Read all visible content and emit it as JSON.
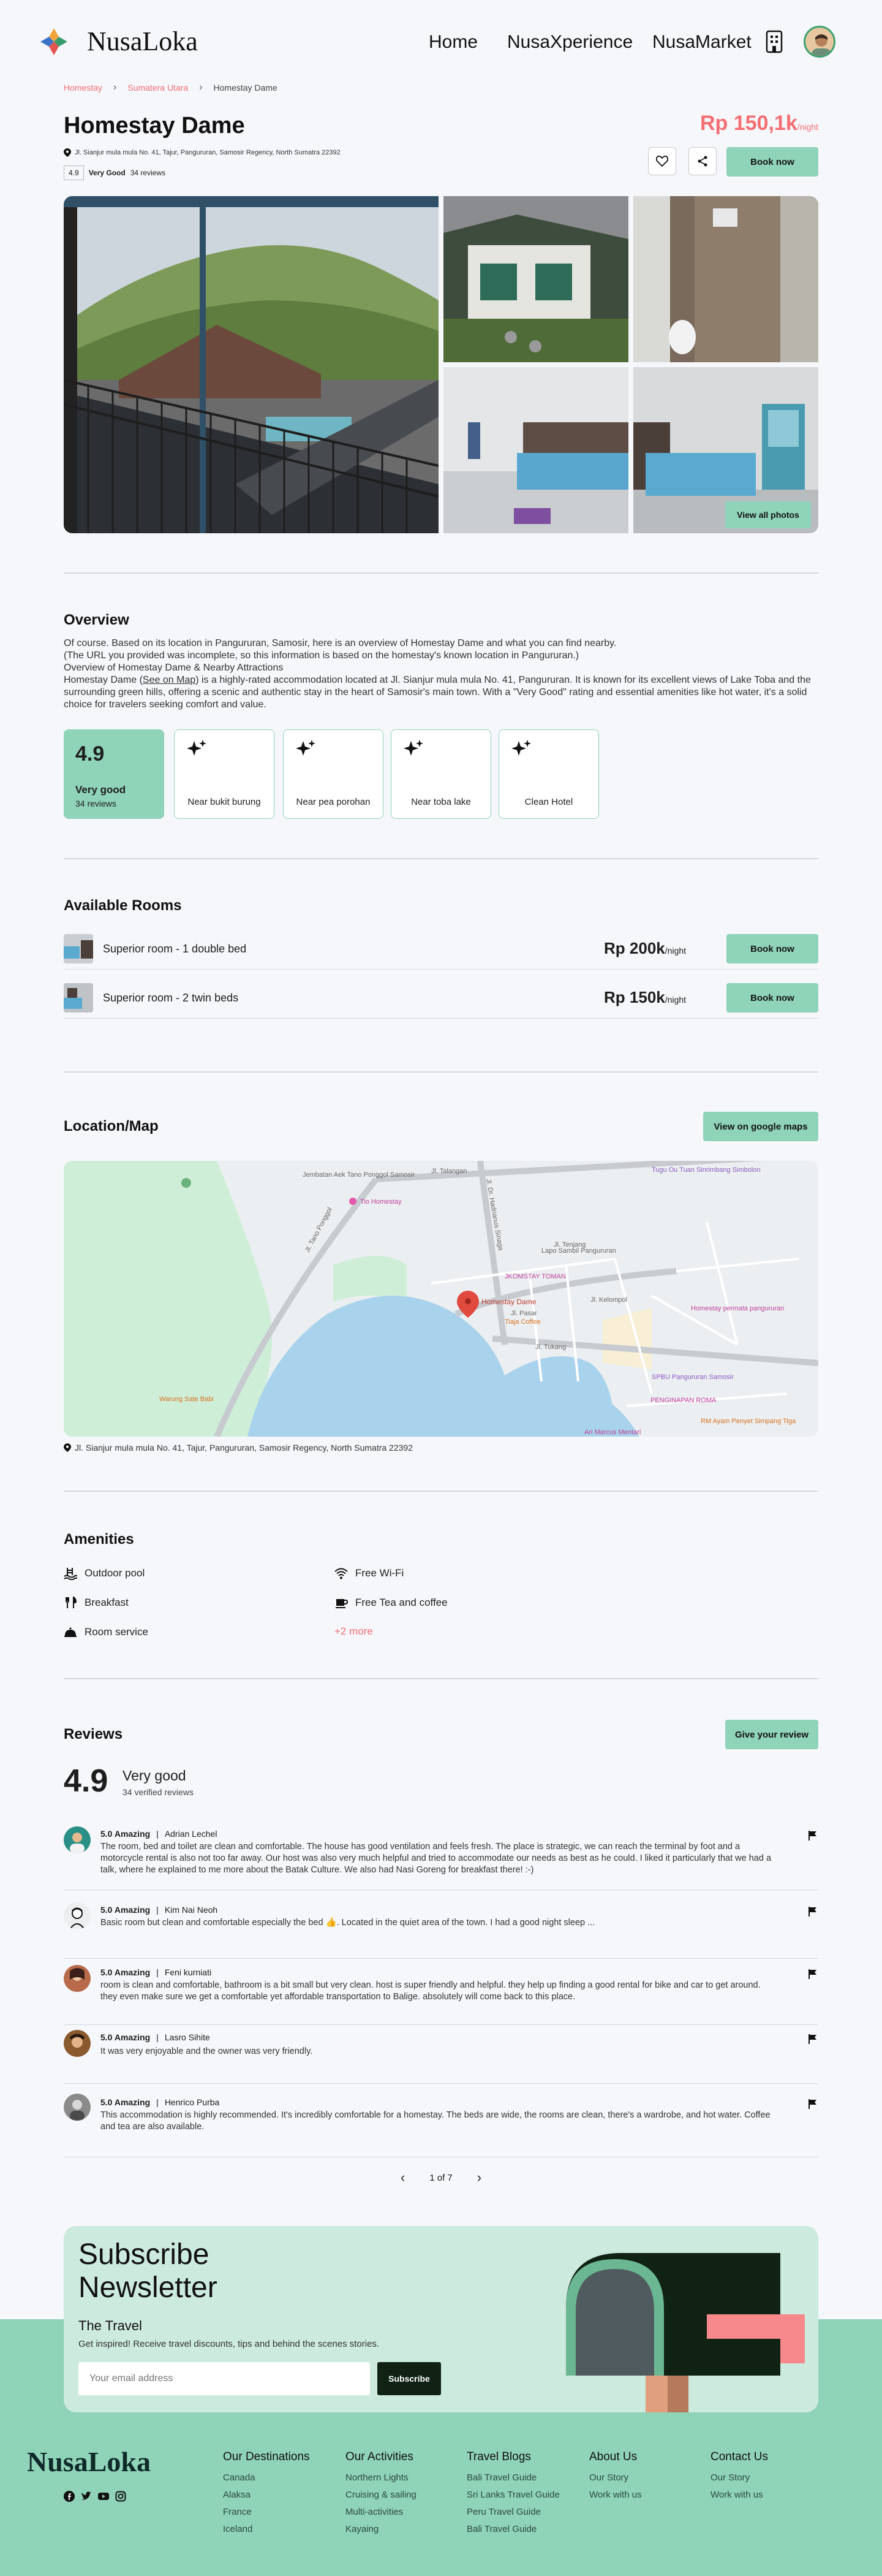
{
  "header": {
    "logo_text": "NusaLoka",
    "nav": [
      "Home",
      "NusaXperience",
      "NusaMarket"
    ]
  },
  "breadcrumb": [
    "Homestay",
    "Sumatera Utara",
    "Homestay Dame"
  ],
  "property": {
    "title": "Homestay Dame",
    "address": "Jl. Sianjur mula mula No. 41, Tajur, Pangururan, Samosir Regency, North Sumatra 22392",
    "rating": "4.9",
    "rating_label": "Very Good",
    "reviews_count": "34 reviews",
    "price": "Rp 150,1k",
    "price_unit": "/night",
    "book_label": "Book now",
    "view_all_label": "View all photos"
  },
  "overview": {
    "heading": "Overview",
    "lines": [
      "Of course. Based on its location in Pangururan, Samosir, here is an overview of Homestay Dame and what you can find nearby.",
      "(The URL you provided was incomplete, so this information is based on the homestay's known location in Pangururan.)",
      "Overview of Homestay Dame & Nearby Attractions"
    ],
    "para_before_link": "Homestay Dame (",
    "link_text": "See on Map",
    "para_after_link": ") is a highly-rated accommodation located at Jl. Sianjur mula mula No. 41, Pangururan. It is known for its excellent views of Lake Toba and the surrounding green hills, offering a scenic and authentic stay in the heart of Samosir's main town. With a \"Very Good\" rating and essential amenities like hot water, it's a solid choice for travelers seeking comfort and value.",
    "score": "4.9",
    "score_label": "Very good",
    "score_reviews": "34 reviews",
    "features": [
      "Near bukit burung",
      "Near pea porohan",
      "Near toba lake",
      "Clean Hotel"
    ]
  },
  "rooms": {
    "heading": "Available Rooms",
    "items": [
      {
        "name": "Superior room - 1 double bed",
        "price": "Rp 200k",
        "unit": "/night",
        "button": "Book now"
      },
      {
        "name": "Superior room -  2 twin beds",
        "price": "Rp 150k",
        "unit": "/night",
        "button": "Book now"
      }
    ]
  },
  "map": {
    "heading": "Location/Map",
    "button": "View on google maps",
    "labels": {
      "pin": "Homestay Dame",
      "l1": "Jembatan Aek Tano Ponggol Samosir",
      "l2": "Tio Homestay",
      "l3": "Tugu Ou Tuan Sinrimbang Simbolon",
      "l4": "Lapo Sambil Pangururan",
      "l5": "JKOMSTAY TOMAN",
      "l6": "Tiaja Coffee",
      "l7": "Homestay permata pangururan",
      "l8": "SPBU Pangururan Samosir",
      "l9": "PENGINAPAN ROMA",
      "l10": "RM Ayam Penyet Simpang Tiga",
      "l11": "Warung Sate Babi",
      "l12": "Ari Marcus Mentari",
      "r1": "Jl. Tano Ponggol",
      "r2": "Jl. Talangan",
      "r3": "Jl. Dr. Hadrianus Sinaga",
      "r4": "Jl. Tenjang",
      "r5": "Jl. Pasar",
      "r6": "Jl. Kelompol",
      "r7": "Jl. Tukang"
    },
    "address": "Jl. Sianjur mula mula No. 41, Tajur, Pangururan, Samosir Regency, North Sumatra 22392"
  },
  "amenities": {
    "heading": "Amenities",
    "left": [
      "Outdoor pool",
      "Breakfast",
      "Room service"
    ],
    "right": [
      "Free Wi-Fi",
      "Free Tea and coffee"
    ],
    "more": "+2 more"
  },
  "reviews": {
    "heading": "Reviews",
    "button": "Give your review",
    "score": "4.9",
    "label": "Very good",
    "count": "34 verified reviews",
    "items": [
      {
        "score": "5.0 Amazing",
        "sep": "|",
        "name": "Adrian Lechel",
        "body": "The room, bed and toilet are clean and comfortable. The house has good ventilation and feels fresh. The place is strategic, we can reach the terminal by foot and a motorcycle rental is also not too far away. Our host was also very much helpful and tried to accommodate our needs as best as he could. I liked it particularly that we had a talk, where he explained to me more about the Batak Culture. We also had Nasi Goreng for breakfast there! :-)"
      },
      {
        "score": "5.0 Amazing",
        "sep": "|",
        "name": "Kim Nai Neoh",
        "body": "Basic room but clean and comfortable especially the bed 👍. Located in the quiet area of the town. I had a good night sleep ..."
      },
      {
        "score": "5.0 Amazing",
        "sep": "|",
        "name": "Feni kurniati",
        "body": "room is clean and comfortable, bathroom is a bit small but very clean. host is super friendly and helpful. they help up finding a good rental for bike and car to get around. they even make sure we get a comfortable yet affordable transportation to Balige. absolutely will come back to this place."
      },
      {
        "score": "5.0 Amazing",
        "sep": "|",
        "name": "Lasro Sihite",
        "body": "It was very enjoyable and the owner was very friendly."
      },
      {
        "score": "5.0 Amazing",
        "sep": "|",
        "name": "Henrico Purba",
        "body": "This accommodation is highly recommended. It's incredibly comfortable for a homestay. The beds are wide, the rooms are clean, there's a wardrobe, and hot water. Coffee and tea are also available."
      }
    ],
    "pager": "1 of 7"
  },
  "newsletter": {
    "title_line1": "Subscribe",
    "title_line2": "Newsletter",
    "subtitle": "The Travel",
    "desc": "Get inspired! Receive travel discounts, tips and behind the scenes stories.",
    "placeholder": "Your email address",
    "button": "Subscribe"
  },
  "footer": {
    "logo_text": "NusaLoka",
    "columns": [
      {
        "title": "Our Destinations",
        "items": [
          "Canada",
          "Alaksa",
          "France",
          "Iceland"
        ]
      },
      {
        "title": "Our Activities",
        "items": [
          "Northern Lights",
          "Cruising & sailing",
          "Multi-activities",
          "Kayaing"
        ]
      },
      {
        "title": "Travel Blogs",
        "items": [
          "Bali Travel Guide",
          "Sri Lanks Travel Guide",
          "Peru Travel Guide",
          "Bali Travel Guide"
        ]
      },
      {
        "title": "About Us",
        "items": [
          "Our Story",
          "Work with us"
        ]
      },
      {
        "title": "Contact Us",
        "items": [
          "Our Story",
          "Work with us"
        ]
      }
    ]
  },
  "colors": {
    "accent_green": "#8fd3b9",
    "accent_red": "#f36f73",
    "dark": "#0f2214"
  }
}
